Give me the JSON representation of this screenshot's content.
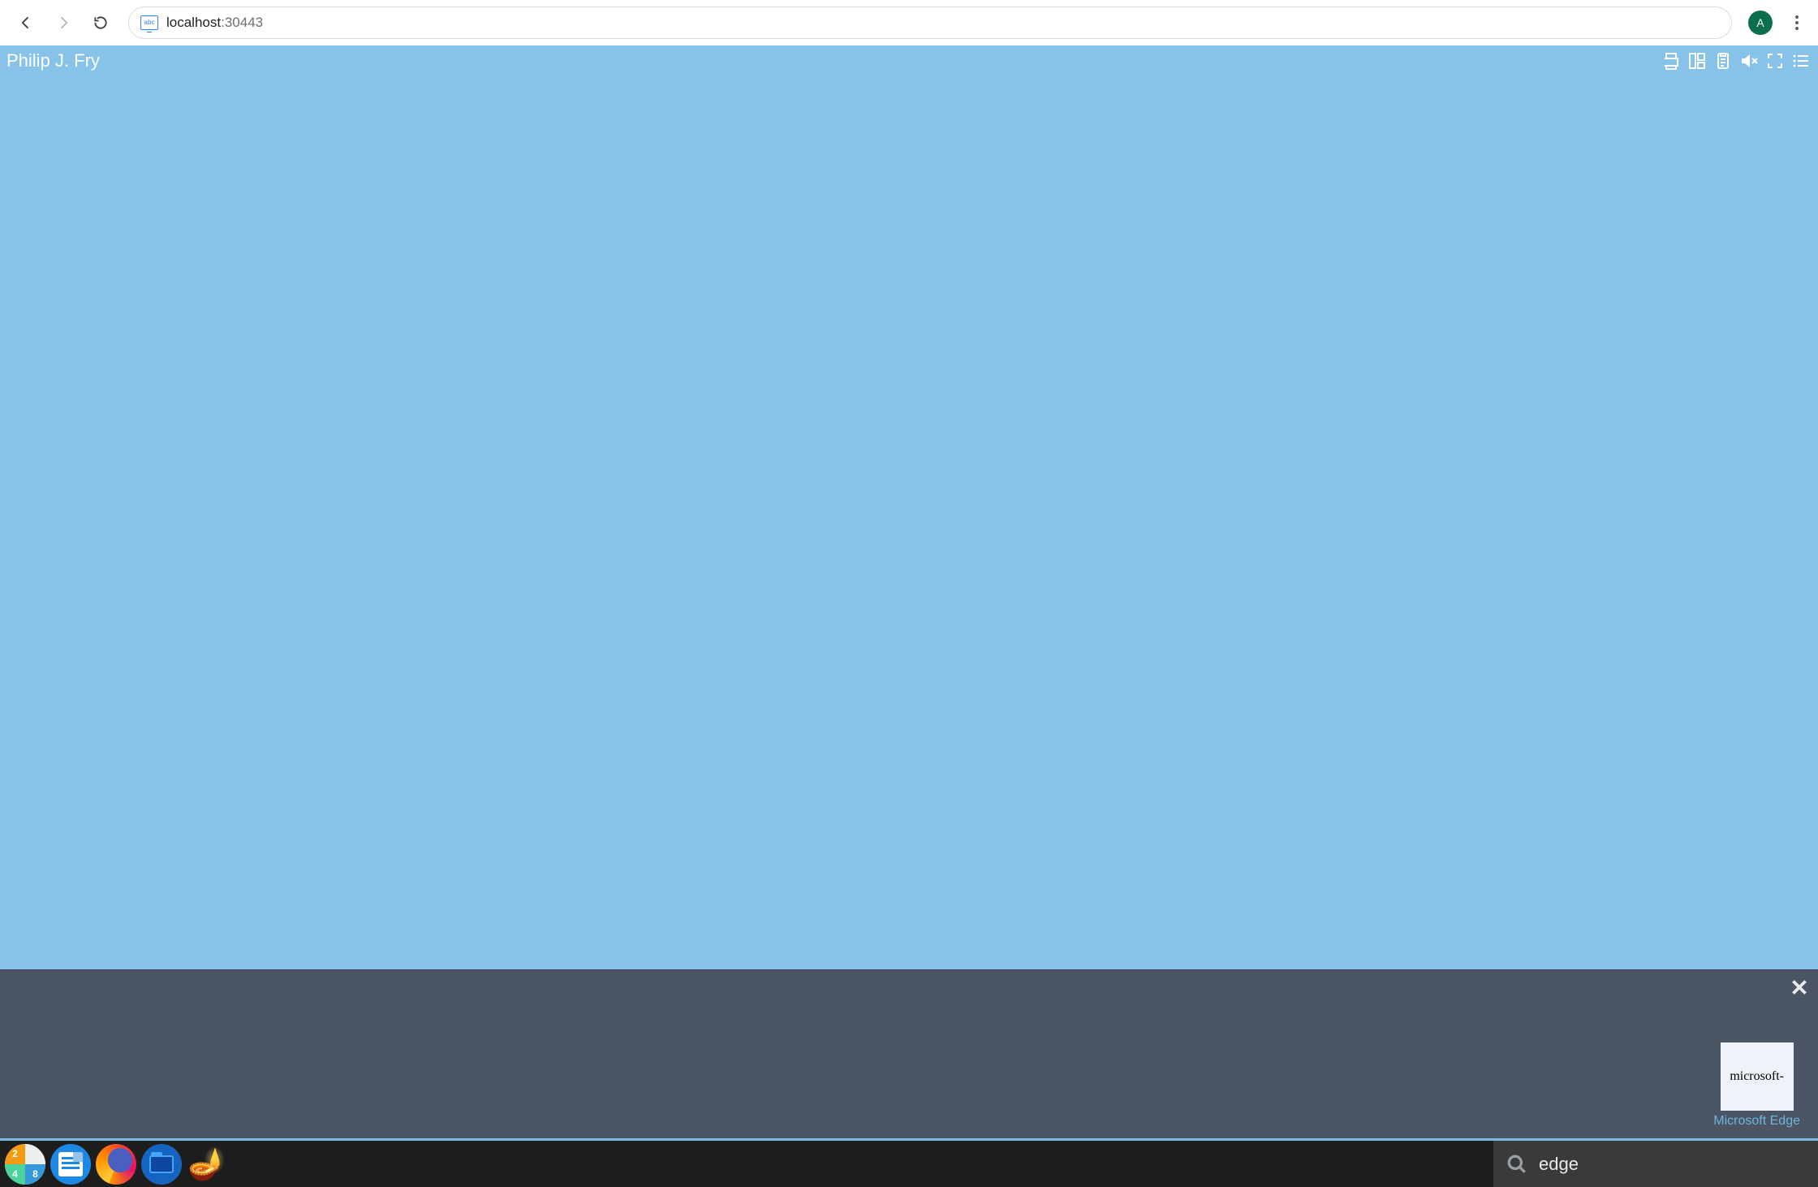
{
  "browser": {
    "url_host": "localhost",
    "url_port": ":30443",
    "site_badge": "abc",
    "avatar_initial": "A"
  },
  "desktop": {
    "user_name": "Philip J. Fry"
  },
  "launcher": {
    "q1": "2",
    "q2": "",
    "q3": "4",
    "q4": "8"
  },
  "search_panel": {
    "result_tile_text": "microsoft-",
    "result_label": "Microsoft Edge"
  },
  "taskbar": {
    "search_value": "edge"
  }
}
